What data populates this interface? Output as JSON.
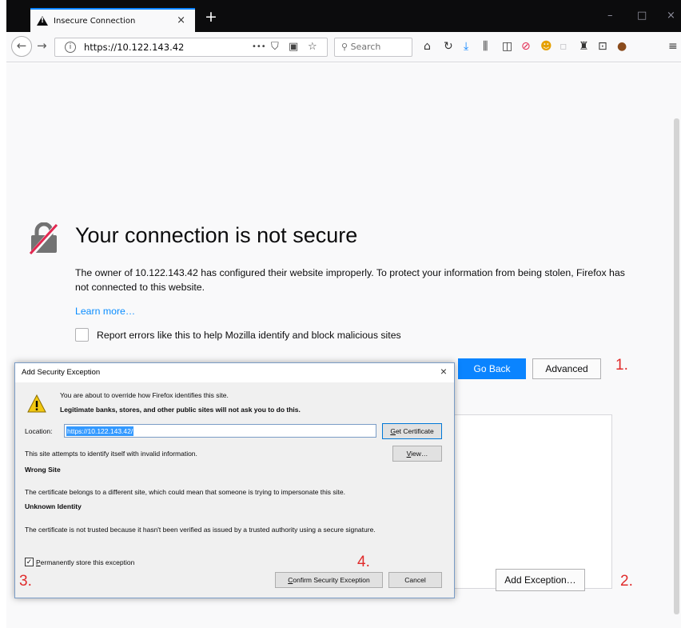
{
  "browser": {
    "tab_title": "Insecure Connection",
    "tab_close": "×",
    "new_tab": "+",
    "url": "https://10.122.143.42",
    "search_placeholder": "Search",
    "more_glyph": "•••",
    "window_controls": {
      "minimize": "–",
      "maximize": "□",
      "close": "×"
    }
  },
  "error_page": {
    "title": "Your connection is not secure",
    "description": "The owner of 10.122.143.42 has configured their website improperly. To protect your information from being stolen, Firefox has not connected to this website.",
    "learn_more": "Learn more…",
    "report_label": "Report errors like this to help Mozilla identify and block malicious sites",
    "go_back": "Go Back",
    "advanced": "Advanced",
    "add_exception": "Add Exception…"
  },
  "annotations": {
    "a1": "1.",
    "a2": "2.",
    "a3": "3.",
    "a4": "4."
  },
  "dialog": {
    "title": "Add Security Exception",
    "close": "×",
    "line1": "You are about to override how Firefox identifies this site.",
    "line2": "Legitimate banks, stores, and other public sites will not ask you to do this.",
    "location_label": "Location:",
    "location_value": "https://10.122.143.42/",
    "get_certificate": "Get Certificate",
    "invalid_info": "This site attempts to identify itself with invalid information.",
    "view": "View…",
    "wrong_site_heading": "Wrong Site",
    "wrong_site_text": "The certificate belongs to a different site, which could mean that someone is trying to impersonate this site.",
    "unknown_identity_heading": "Unknown Identity",
    "unknown_identity_text": "The certificate is not trusted because it hasn't been verified as issued by a trusted authority using a secure signature.",
    "permanent_label": "Permanently store this exception",
    "permanent_checked": true,
    "confirm": "Confirm Security Exception",
    "cancel": "Cancel"
  },
  "colors": {
    "accent": "#0a84ff",
    "annotation": "#e02b2b",
    "link": "#0a8dff"
  }
}
